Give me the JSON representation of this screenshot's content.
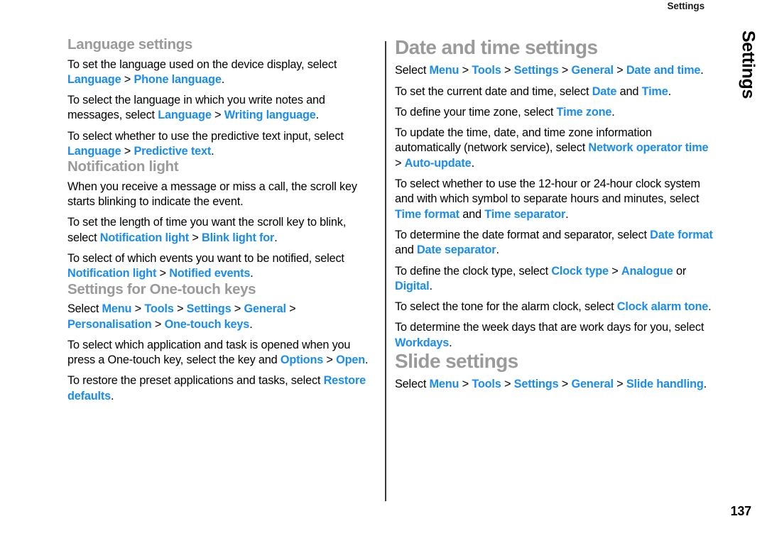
{
  "page": {
    "running_header": "Settings",
    "side_tab_label": "Settings",
    "page_number": "137",
    "accent_color": "#1a8cf0",
    "heading_color": "#9a9a9a",
    "body_color": "#000000",
    "background_color": "#ffffff"
  },
  "left_column": {
    "section_1": {
      "heading": "Language settings",
      "paragraphs": [
        {
          "runs": [
            {
              "text": "To set the language used on the device display, select ",
              "style": "plain"
            },
            {
              "text": "Language",
              "style": "ui"
            },
            {
              "text": " > ",
              "style": "sep"
            },
            {
              "text": "Phone language",
              "style": "ui"
            },
            {
              "text": ".",
              "style": "plain"
            }
          ]
        },
        {
          "runs": [
            {
              "text": "To select the language in which you write notes and messages, select ",
              "style": "plain"
            },
            {
              "text": "Language",
              "style": "ui"
            },
            {
              "text": " > ",
              "style": "sep"
            },
            {
              "text": "Writing language",
              "style": "ui"
            },
            {
              "text": ".",
              "style": "plain"
            }
          ]
        },
        {
          "runs": [
            {
              "text": "To select whether to use the predictive text input, select ",
              "style": "plain"
            },
            {
              "text": "Language",
              "style": "ui"
            },
            {
              "text": " > ",
              "style": "sep"
            },
            {
              "text": "Predictive text",
              "style": "ui"
            },
            {
              "text": ".",
              "style": "plain"
            }
          ]
        }
      ]
    },
    "section_2": {
      "heading": "Notification light",
      "paragraphs": [
        {
          "runs": [
            {
              "text": "When you receive a message or miss a call, the scroll key starts blinking to indicate the event.",
              "style": "plain"
            }
          ]
        },
        {
          "runs": [
            {
              "text": "To set the length of time you want the scroll key to blink, select ",
              "style": "plain"
            },
            {
              "text": "Notification light",
              "style": "ui"
            },
            {
              "text": " > ",
              "style": "sep"
            },
            {
              "text": "Blink light for",
              "style": "ui"
            },
            {
              "text": ".",
              "style": "plain"
            }
          ]
        },
        {
          "runs": [
            {
              "text": "To select of which events you want to be notified, select ",
              "style": "plain"
            },
            {
              "text": "Notification light",
              "style": "ui"
            },
            {
              "text": " > ",
              "style": "sep"
            },
            {
              "text": "Notified events",
              "style": "ui"
            },
            {
              "text": ".",
              "style": "plain"
            }
          ]
        }
      ]
    },
    "section_3": {
      "heading": "Settings for One-touch keys",
      "paragraphs": [
        {
          "runs": [
            {
              "text": "Select ",
              "style": "plain"
            },
            {
              "text": "Menu",
              "style": "ui"
            },
            {
              "text": " > ",
              "style": "sep"
            },
            {
              "text": "Tools",
              "style": "ui"
            },
            {
              "text": " > ",
              "style": "sep"
            },
            {
              "text": "Settings",
              "style": "ui"
            },
            {
              "text": " > ",
              "style": "sep"
            },
            {
              "text": "General",
              "style": "ui"
            },
            {
              "text": " > ",
              "style": "sep"
            },
            {
              "text": "Personalisation",
              "style": "ui"
            },
            {
              "text": " > ",
              "style": "sep"
            },
            {
              "text": "One-touch keys",
              "style": "ui"
            },
            {
              "text": ".",
              "style": "plain"
            }
          ]
        },
        {
          "runs": [
            {
              "text": "To select which application and task is opened when you press a One-touch key, select the key and ",
              "style": "plain"
            },
            {
              "text": "Options",
              "style": "ui"
            },
            {
              "text": " > ",
              "style": "sep"
            },
            {
              "text": "Open",
              "style": "ui"
            },
            {
              "text": ".",
              "style": "plain"
            }
          ]
        },
        {
          "runs": [
            {
              "text": "To restore the preset applications and tasks, select ",
              "style": "plain"
            },
            {
              "text": "Restore defaults",
              "style": "ui"
            },
            {
              "text": ".",
              "style": "plain"
            }
          ]
        }
      ]
    }
  },
  "right_column": {
    "section_1": {
      "heading": "Date and time settings",
      "paragraphs": [
        {
          "runs": [
            {
              "text": "Select ",
              "style": "plain"
            },
            {
              "text": "Menu",
              "style": "ui"
            },
            {
              "text": " > ",
              "style": "sep"
            },
            {
              "text": "Tools",
              "style": "ui"
            },
            {
              "text": " > ",
              "style": "sep"
            },
            {
              "text": "Settings",
              "style": "ui"
            },
            {
              "text": " > ",
              "style": "sep"
            },
            {
              "text": "General",
              "style": "ui"
            },
            {
              "text": " > ",
              "style": "sep"
            },
            {
              "text": "Date and time",
              "style": "ui"
            },
            {
              "text": ".",
              "style": "plain"
            }
          ]
        },
        {
          "runs": [
            {
              "text": "To set the current date and time, select ",
              "style": "plain"
            },
            {
              "text": "Date",
              "style": "ui"
            },
            {
              "text": " and ",
              "style": "plain"
            },
            {
              "text": "Time",
              "style": "ui"
            },
            {
              "text": ".",
              "style": "plain"
            }
          ]
        },
        {
          "runs": [
            {
              "text": "To define your time zone, select ",
              "style": "plain"
            },
            {
              "text": "Time zone",
              "style": "ui"
            },
            {
              "text": ".",
              "style": "plain"
            }
          ]
        },
        {
          "runs": [
            {
              "text": "To update the time, date, and time zone information automatically (network service), select ",
              "style": "plain"
            },
            {
              "text": "Network operator time",
              "style": "ui"
            },
            {
              "text": " > ",
              "style": "sep"
            },
            {
              "text": "Auto-update",
              "style": "ui"
            },
            {
              "text": ".",
              "style": "plain"
            }
          ]
        },
        {
          "runs": [
            {
              "text": "To select whether to use the 12-hour or 24-hour clock system and with which symbol to separate hours and minutes, select ",
              "style": "plain"
            },
            {
              "text": "Time format",
              "style": "ui"
            },
            {
              "text": " and ",
              "style": "plain"
            },
            {
              "text": "Time separator",
              "style": "ui"
            },
            {
              "text": ".",
              "style": "plain"
            }
          ]
        },
        {
          "runs": [
            {
              "text": "To determine the date format and separator, select ",
              "style": "plain"
            },
            {
              "text": "Date format",
              "style": "ui"
            },
            {
              "text": " and ",
              "style": "plain"
            },
            {
              "text": "Date separator",
              "style": "ui"
            },
            {
              "text": ".",
              "style": "plain"
            }
          ]
        },
        {
          "runs": [
            {
              "text": "To define the clock type, select ",
              "style": "plain"
            },
            {
              "text": "Clock type",
              "style": "ui"
            },
            {
              "text": " > ",
              "style": "sep"
            },
            {
              "text": "Analogue",
              "style": "ui"
            },
            {
              "text": " or ",
              "style": "plain"
            },
            {
              "text": "Digital",
              "style": "ui"
            },
            {
              "text": ".",
              "style": "plain"
            }
          ]
        },
        {
          "runs": [
            {
              "text": "To select the tone for the alarm clock, select ",
              "style": "plain"
            },
            {
              "text": "Clock alarm tone",
              "style": "ui"
            },
            {
              "text": ".",
              "style": "plain"
            }
          ]
        },
        {
          "runs": [
            {
              "text": "To determine the week days that are work days for you, select ",
              "style": "plain"
            },
            {
              "text": "Workdays",
              "style": "ui"
            },
            {
              "text": ".",
              "style": "plain"
            }
          ]
        }
      ]
    },
    "section_2": {
      "heading": "Slide settings",
      "paragraphs": [
        {
          "runs": [
            {
              "text": "Select ",
              "style": "plain"
            },
            {
              "text": "Menu",
              "style": "ui"
            },
            {
              "text": " > ",
              "style": "sep"
            },
            {
              "text": "Tools",
              "style": "ui"
            },
            {
              "text": " > ",
              "style": "sep"
            },
            {
              "text": "Settings",
              "style": "ui"
            },
            {
              "text": " > ",
              "style": "sep"
            },
            {
              "text": "General",
              "style": "ui"
            },
            {
              "text": " > ",
              "style": "sep"
            },
            {
              "text": "Slide handling",
              "style": "ui"
            },
            {
              "text": ".",
              "style": "plain"
            }
          ]
        }
      ]
    }
  }
}
